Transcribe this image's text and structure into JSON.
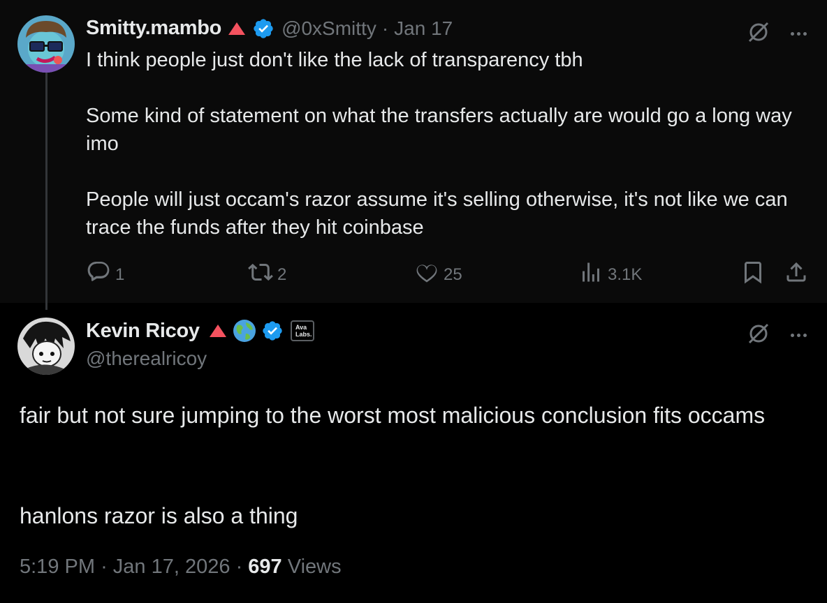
{
  "reply": {
    "author": {
      "display_name": "Smitty.mambo",
      "handle": "@0xSmitty",
      "separator": "·",
      "date": "Jan 17"
    },
    "text": "I think people just don't like the lack of transparency tbh\n\nSome kind of statement on what the transfers actually are would go a long way imo\n\nPeople will just occam's razor assume it's selling otherwise, it's not like we can trace the funds after they hit coinbase",
    "actions": {
      "replies": "1",
      "reposts": "2",
      "likes": "25",
      "views": "3.1K"
    }
  },
  "main": {
    "author": {
      "display_name": "Kevin Ricoy",
      "handle": "@therealricoy",
      "affiliate_badge_text": "Ava Labs"
    },
    "text": "fair but not sure jumping to the worst most malicious conclusion fits occams\n\n\nhanlons razor is also a thing",
    "footer": {
      "time": "5:19 PM",
      "separator": "·",
      "date": "Jan 17, 2026",
      "views_count": "697",
      "views_label": "Views"
    }
  },
  "colors": {
    "background": "#000000",
    "reply_background": "#0a0a0a",
    "text": "#e7e9ea",
    "muted": "#71767b",
    "verified_blue": "#1d9bf0",
    "triangle_red": "#f4525f"
  },
  "icons": {
    "triangle": "red-triangle-icon",
    "verified": "verified-badge-icon",
    "globe": "globe-icon",
    "grok": "grok-icon",
    "more": "more-icon",
    "reply": "reply-icon",
    "repost": "repost-icon",
    "like": "heart-icon",
    "views": "analytics-icon",
    "bookmark": "bookmark-icon",
    "share": "share-icon"
  }
}
